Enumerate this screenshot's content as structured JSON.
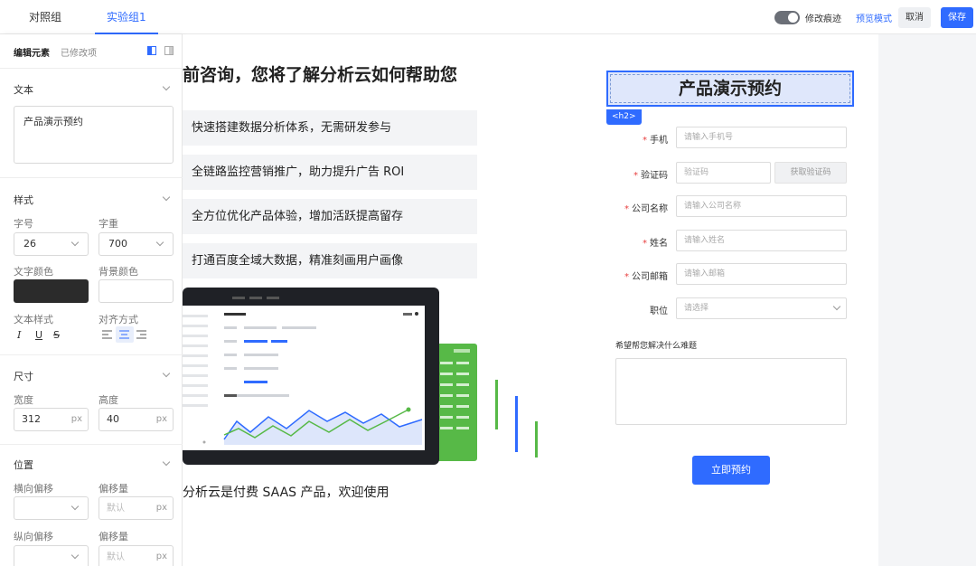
{
  "tabs": [
    "对照组",
    "实验组1"
  ],
  "toolbar": {
    "track_changes": "修改痕迹",
    "preview": "预览模式",
    "cancel": "取消",
    "save": "保存"
  },
  "left_panel": {
    "tab_edit": "编辑元素",
    "tab_modified": "已修改项",
    "text_section": "文本",
    "text_value": "产品演示预约",
    "style_section": "样式",
    "font_size_label": "字号",
    "font_size_value": "26",
    "font_weight_label": "字重",
    "font_weight_value": "700",
    "text_color_label": "文字颜色",
    "text_color": "#2b2b2b",
    "bg_color_label": "背景颜色",
    "text_style_label": "文本样式",
    "align_label": "对齐方式",
    "size_section": "尺寸",
    "width_label": "宽度",
    "width_value": "312",
    "height_label": "高度",
    "height_value": "40",
    "unit": "px",
    "position_section": "位置",
    "h_offset_label": "横向偏移",
    "offset_label": "偏移量",
    "default_placeholder": "默认",
    "v_offset_label": "纵向偏移",
    "offset_label2": "偏移量"
  },
  "canvas": {
    "headline": "前咨询，您将了解分析云如何帮助您",
    "features": [
      "快速搭建数据分析体系，无需研发参与",
      "全链路监控营销推广，助力提升广告 ROI",
      "全方位优化产品体验，增加活跃提高留存",
      "打通百度全域大数据，精准刻画用户画像"
    ],
    "bottom_text": "分析云是付费 SAAS 产品，欢迎使用"
  },
  "form": {
    "title": "产品演示预约",
    "tag": "<h2>",
    "fields": [
      {
        "label": "手机",
        "placeholder": "请输入手机号"
      },
      {
        "label": "验证码",
        "placeholder": "验证码"
      },
      {
        "label": "公司名称",
        "placeholder": "请输入公司名称"
      },
      {
        "label": "姓名",
        "placeholder": "请输入姓名"
      },
      {
        "label": "公司邮箱",
        "placeholder": "请输入邮箱"
      },
      {
        "label": "职位",
        "placeholder": "请选择"
      }
    ],
    "get_code": "获取验证码",
    "problem_label": "希望帮您解决什么难题",
    "submit": "立即预约"
  },
  "colors": {
    "accent": "#2f6bff",
    "required": "#e84040",
    "dashboard_green": "#57b947"
  }
}
